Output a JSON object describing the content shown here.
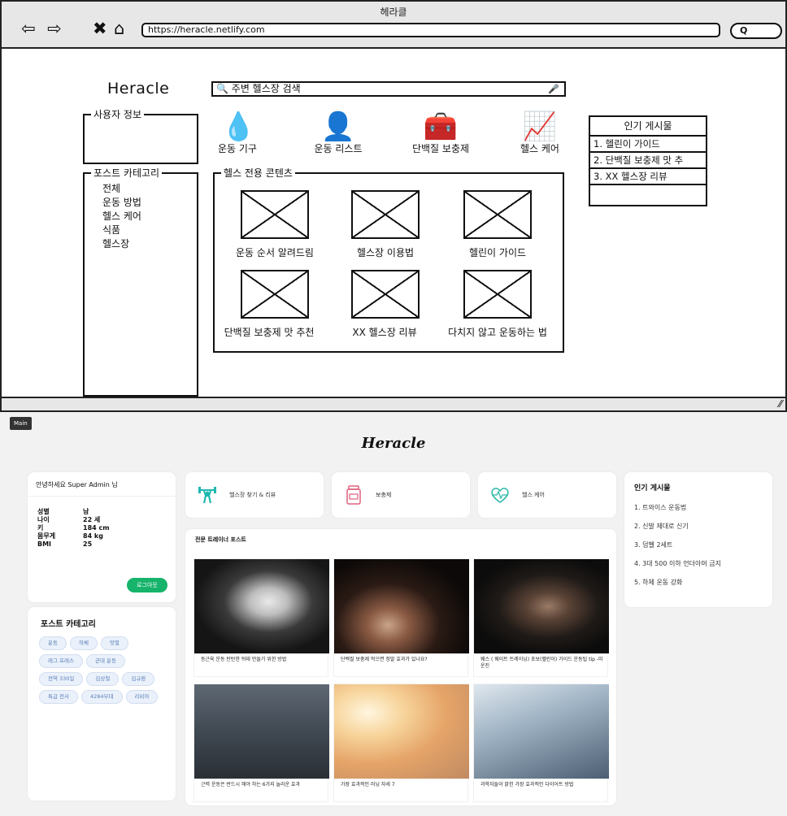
{
  "wireframe": {
    "window_title": "헤라클",
    "url": "https://heracle.netlify.com",
    "search_pill": "Q",
    "logo": "Heracle",
    "search_placeholder": "주변 헬스장 검색",
    "user_info_label": "사용자 정보",
    "category_label": "포스트 카테고리",
    "categories": [
      "전체",
      "운동 방법",
      "헬스 케어",
      "식품",
      "헬스장"
    ],
    "icons": [
      {
        "label": "운동 기구",
        "icon": "drop-icon"
      },
      {
        "label": "운동 리스트",
        "icon": "person-icon"
      },
      {
        "label": "단백질 보충제",
        "icon": "medkit-icon"
      },
      {
        "label": "헬스 케어",
        "icon": "chart-icon"
      }
    ],
    "content_label": "헬스 전용 콘텐츠",
    "contents": [
      "운동 순서 알려드림",
      "헬스장 이용법",
      "헬린이 가이드",
      "단백질 보충제 맛 추천",
      "XX 헬스장 리뷰",
      "다치지 않고 운동하는 법"
    ],
    "popular_title": "인기 게시물",
    "popular_items": [
      "1. 헬린이 가이드",
      "2. 단백질 보충제 맛 추",
      "3. XX 헬스장 리뷰"
    ]
  },
  "page": {
    "tag": "Main",
    "brand": "Heracle",
    "user": {
      "greeting": "안녕하세요 Super Admin 님",
      "rows": [
        {
          "k": "성별",
          "v": "남"
        },
        {
          "k": "나이",
          "v": "22 세"
        },
        {
          "k": "키",
          "v": "184 cm"
        },
        {
          "k": "몸무게",
          "v": "84 kg"
        },
        {
          "k": "BMI",
          "v": "25"
        }
      ],
      "logout": "로그아웃"
    },
    "category": {
      "title": "포스트 카테고리",
      "chips": [
        "운동",
        "하체",
        "맛별",
        "레그 프레스",
        "군대 운동",
        "전역 330일",
        "김상철",
        "김규환",
        "특급 전사",
        "4284부대",
        "리비아"
      ]
    },
    "features": [
      {
        "label": "헬스장 찾기 & 리뷰",
        "icon": "weightlifter-icon",
        "color": "#1fb8b0"
      },
      {
        "label": "보충제",
        "icon": "supplement-jar-icon",
        "color": "#e0607e"
      },
      {
        "label": "헬스 케어",
        "icon": "heartbeat-icon",
        "color": "#2bb8a8"
      }
    ],
    "posts_title": "전문 트레이너 포스트",
    "posts": [
      "등근육 운동 탄탄한 뒤태 만들기 위한 방법",
      "단백질 보충제 먹으면 정말 효과가 있나요?",
      "웨스 ( 웨이트 트레이닝) 초보(헬린이) 가이드 운동팁 tip -미운진",
      "근력 운동은 반드시 해야 하는 6가지 놀라운 효과",
      "가장 효과적인 러닝 자세 7",
      "과학자들이 밝힌 가장 효과적인 다이어트 방법"
    ],
    "popular": {
      "title": "인기 게시물",
      "items": [
        "1. 트와이스 운동법",
        "2. 신발 제대로 신기",
        "3. 덤벨 2세트",
        "4. 3대 500 이하 언더아머 금지",
        "5. 하체 운동 강화"
      ]
    },
    "accent": "#16b36a"
  }
}
